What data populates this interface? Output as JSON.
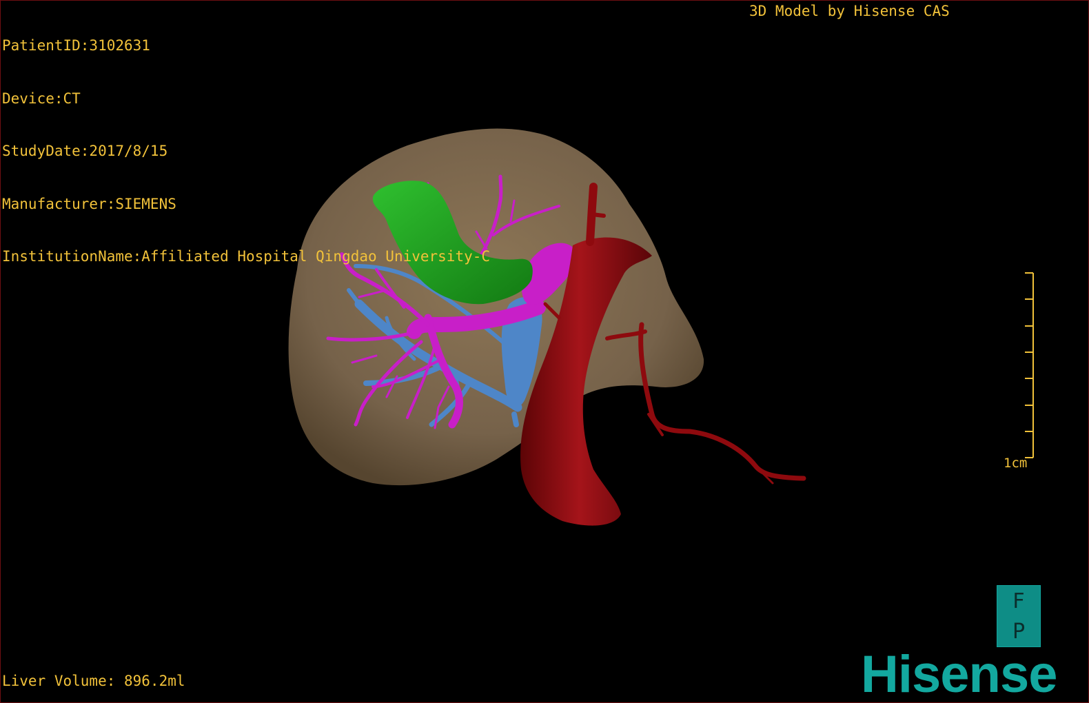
{
  "overlay": {
    "patient_id": "PatientID:3102631",
    "device": "Device:CT",
    "study_date": "StudyDate:2017/8/15",
    "manufacturer": "Manufacturer:SIEMENS",
    "institution": "InstitutionName:Affiliated Hospital Qingdao University-C",
    "credit": "3D Model by Hisense CAS",
    "liver_volume": "Liver Volume: 896.2ml",
    "scale_label": "1cm"
  },
  "orientation": {
    "top": "F",
    "bottom": "P"
  },
  "brand": {
    "logo_text": "Hisense",
    "color": "#13a89f"
  },
  "colors": {
    "text": "#f2c23a",
    "liver": "#7a654a",
    "gallbladder": "#1f9e1f",
    "portal_vein": "#c81fc8",
    "hepatic_vein": "#4e86c8",
    "ivc_artery": "#8e0a0e",
    "border": "#6e0f12"
  }
}
